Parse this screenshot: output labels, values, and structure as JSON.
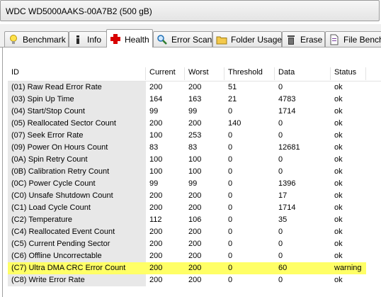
{
  "drive": {
    "label": "WDC WD5000AAKS-00A7B2  (500 gB)"
  },
  "tabs": [
    {
      "label": "Benchmark",
      "icon": "lightbulb-icon",
      "active": false
    },
    {
      "label": "Info",
      "icon": "info-icon",
      "active": false
    },
    {
      "label": "Health",
      "icon": "red-cross-icon",
      "active": true
    },
    {
      "label": "Error Scan",
      "icon": "magnifier-icon",
      "active": false
    },
    {
      "label": "Folder Usage",
      "icon": "folder-icon",
      "active": false
    },
    {
      "label": "Erase",
      "icon": "trash-icon",
      "active": false
    },
    {
      "label": "File Bench",
      "icon": "file-icon",
      "active": false
    }
  ],
  "columns": [
    "ID",
    "Current",
    "Worst",
    "Threshold",
    "Data",
    "Status"
  ],
  "rows": [
    {
      "id": "(01) Raw Read Error Rate",
      "current": "200",
      "worst": "200",
      "threshold": "51",
      "data": "0",
      "status": "ok"
    },
    {
      "id": "(03) Spin Up Time",
      "current": "164",
      "worst": "163",
      "threshold": "21",
      "data": "4783",
      "status": "ok"
    },
    {
      "id": "(04) Start/Stop Count",
      "current": "99",
      "worst": "99",
      "threshold": "0",
      "data": "1714",
      "status": "ok"
    },
    {
      "id": "(05) Reallocated Sector Count",
      "current": "200",
      "worst": "200",
      "threshold": "140",
      "data": "0",
      "status": "ok"
    },
    {
      "id": "(07) Seek Error Rate",
      "current": "100",
      "worst": "253",
      "threshold": "0",
      "data": "0",
      "status": "ok"
    },
    {
      "id": "(09) Power On Hours Count",
      "current": "83",
      "worst": "83",
      "threshold": "0",
      "data": "12681",
      "status": "ok"
    },
    {
      "id": "(0A) Spin Retry Count",
      "current": "100",
      "worst": "100",
      "threshold": "0",
      "data": "0",
      "status": "ok"
    },
    {
      "id": "(0B) Calibration Retry Count",
      "current": "100",
      "worst": "100",
      "threshold": "0",
      "data": "0",
      "status": "ok"
    },
    {
      "id": "(0C) Power Cycle Count",
      "current": "99",
      "worst": "99",
      "threshold": "0",
      "data": "1396",
      "status": "ok"
    },
    {
      "id": "(C0) Unsafe Shutdown Count",
      "current": "200",
      "worst": "200",
      "threshold": "0",
      "data": "17",
      "status": "ok"
    },
    {
      "id": "(C1) Load Cycle Count",
      "current": "200",
      "worst": "200",
      "threshold": "0",
      "data": "1714",
      "status": "ok"
    },
    {
      "id": "(C2) Temperature",
      "current": "112",
      "worst": "106",
      "threshold": "0",
      "data": "35",
      "status": "ok"
    },
    {
      "id": "(C4) Reallocated Event Count",
      "current": "200",
      "worst": "200",
      "threshold": "0",
      "data": "0",
      "status": "ok"
    },
    {
      "id": "(C5) Current Pending Sector",
      "current": "200",
      "worst": "200",
      "threshold": "0",
      "data": "0",
      "status": "ok"
    },
    {
      "id": "(C6) Offline Uncorrectable",
      "current": "200",
      "worst": "200",
      "threshold": "0",
      "data": "0",
      "status": "ok"
    },
    {
      "id": "(C7) Ultra DMA CRC Error Count",
      "current": "200",
      "worst": "200",
      "threshold": "0",
      "data": "60",
      "status": "warning"
    },
    {
      "id": "(C8) Write Error Rate",
      "current": "200",
      "worst": "200",
      "threshold": "0",
      "data": "0",
      "status": "ok"
    }
  ],
  "colors": {
    "warning_highlight": "#ffff66",
    "id_column_bg": "#e8e8e8",
    "health_icon": "#d80000"
  }
}
